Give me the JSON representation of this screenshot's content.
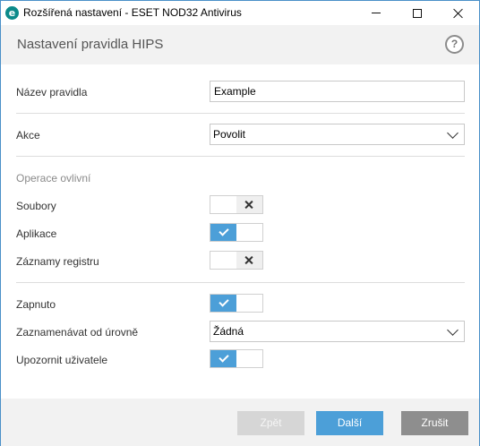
{
  "window": {
    "title": "Rozšířená nastavení - ESET NOD32 Antivirus",
    "logo_letter": "e",
    "brand_color": "#0b8a8a"
  },
  "header": {
    "title": "Nastavení pravidla HIPS",
    "help_label": "?"
  },
  "form": {
    "rule_name": {
      "label": "Název pravidla",
      "value": "Example"
    },
    "action": {
      "label": "Akce",
      "selected": "Povolit"
    },
    "affected_ops": {
      "section_label": "Operace ovlivní",
      "files": {
        "label": "Soubory",
        "state": "off"
      },
      "applications": {
        "label": "Aplikace",
        "state": "on"
      },
      "registry": {
        "label": "Záznamy registru",
        "state": "off"
      }
    },
    "enabled": {
      "label": "Zapnuto",
      "state": "on"
    },
    "log_level": {
      "label": "Zaznamenávat od úrovně",
      "selected": "Žádná"
    },
    "notify_user": {
      "label": "Upozornit uživatele",
      "state": "on"
    }
  },
  "footer": {
    "back_label": "Zpět",
    "next_label": "Další",
    "cancel_label": "Zrušit"
  },
  "colors": {
    "accent": "#4c9fd8",
    "cancel": "#8e8e8e",
    "disabled": "#d6d6d6"
  }
}
